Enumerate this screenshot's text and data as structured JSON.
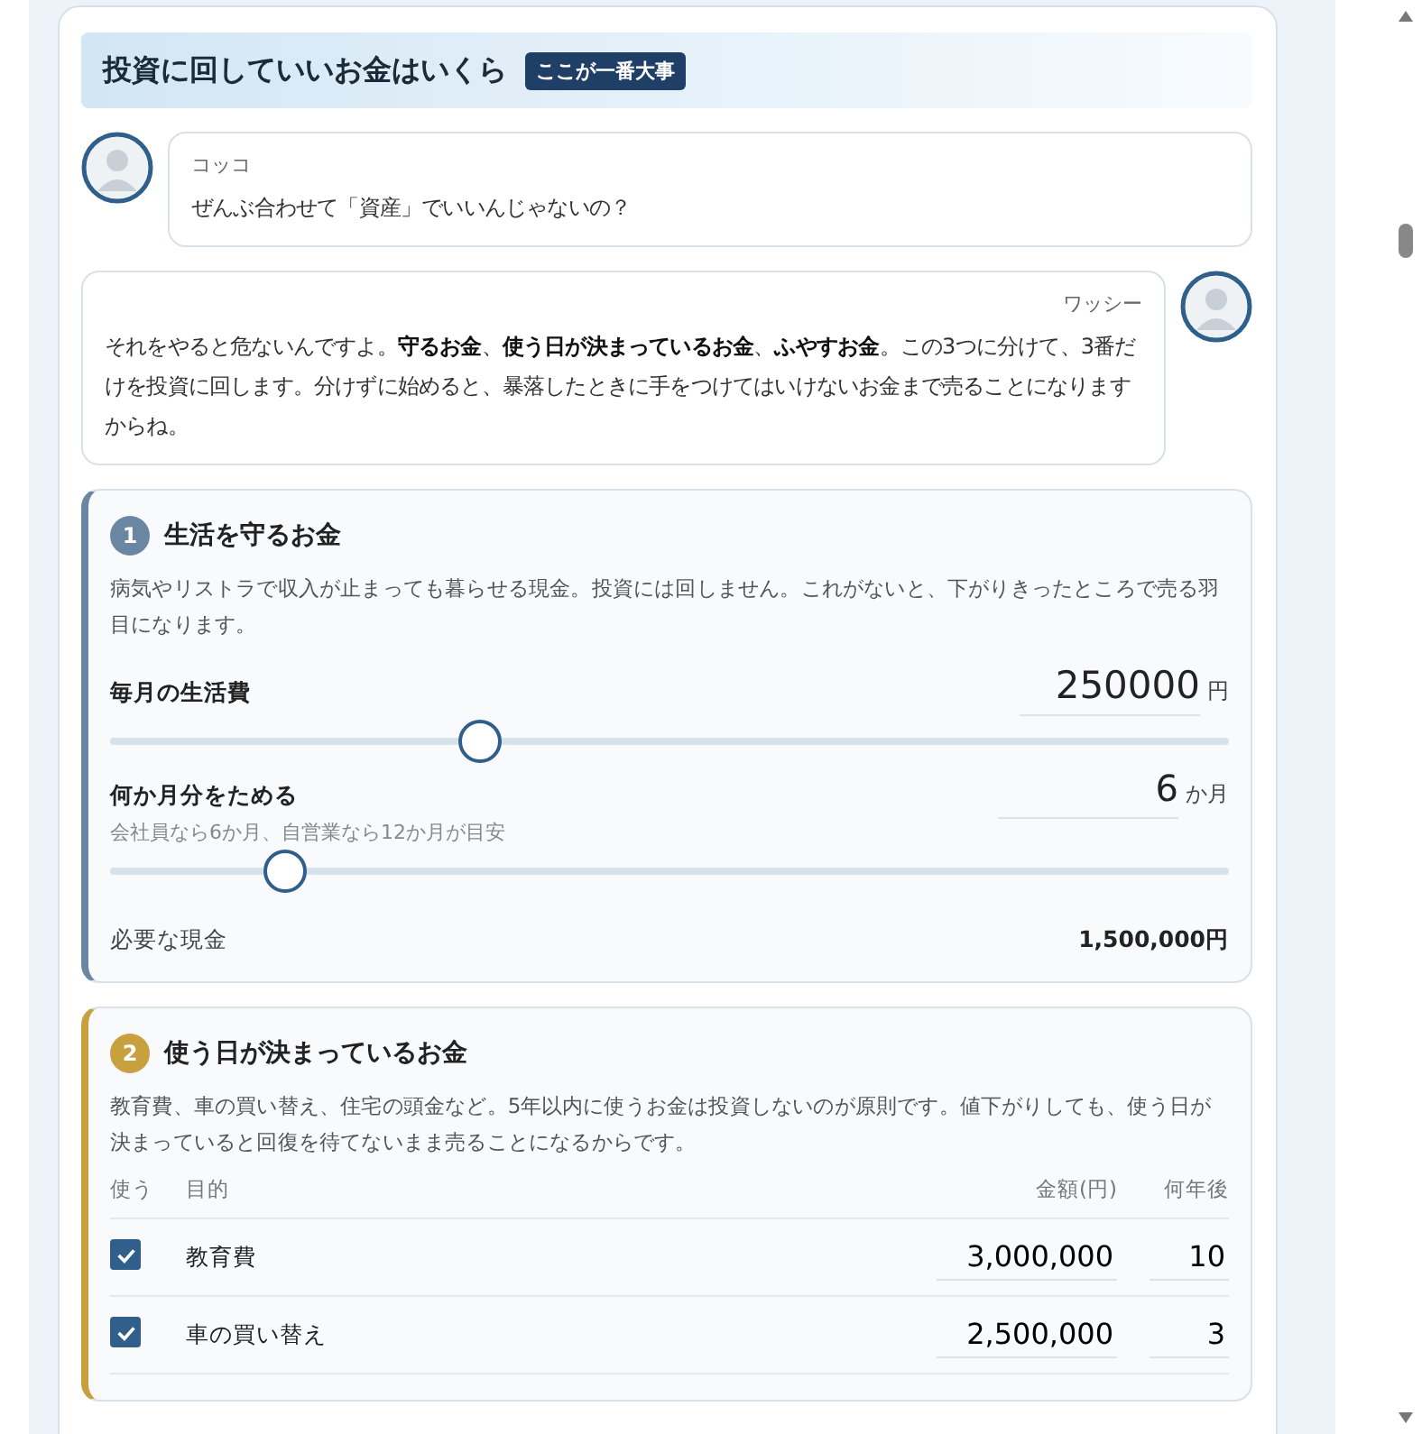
{
  "header": {
    "title": "投資に回していいお金はいくら",
    "badge": "ここが一番大事"
  },
  "chat": [
    {
      "kind": "left",
      "speaker": "コッコ",
      "text": "ぜんぶ合わせて「資産」でいいんじゃないの？"
    },
    {
      "kind": "right",
      "speaker": "ワッシー",
      "text": "それをやると危ないんですよ。**守るお金**、**使う日が決まっているお金**、**ふやすお金**。この3つに分けて、3番だけを投資に回します。分けずに始めると、暴落したときに手をつけてはいけないお金まで売ることになりますからね。"
    }
  ],
  "sections": [
    {
      "kind": "sliders",
      "number": "1",
      "color": "#6b86a3",
      "title": "生活を守るお金",
      "description": "病気やリストラで収入が止まっても暮らせる現金。投資には回しません。これがないと、下がりきったところで売る羽目になります。",
      "sliders": [
        {
          "label": "毎月の生活費",
          "value": "250000",
          "unit": "円",
          "level": 0.33
        },
        {
          "label": "何か月分をためる",
          "hint": "会社員なら6か月、自営業なら12か月が目安",
          "value": "6",
          "unit": "か月",
          "level": 0.157
        }
      ],
      "result": {
        "label": "必要な現金",
        "value": "1,500,000円"
      }
    },
    {
      "kind": "table",
      "number": "2",
      "color": "#c9a040",
      "title": "使う日が決まっているお金",
      "description": "教育費、車の買い替え、住宅の頭金など。5年以内に使うお金は投資しないのが原則です。値下がりしても、使う日が決まっていると回復を待てないまま売ることになるからです。",
      "columns": [
        "使う",
        "目的",
        "金額(円)",
        "何年後"
      ],
      "rows": [
        {
          "checked": true,
          "purpose": "教育費",
          "amount": "3,000,000",
          "years": "10"
        },
        {
          "checked": true,
          "purpose": "車の買い替え",
          "amount": "2,500,000",
          "years": "3"
        }
      ]
    }
  ]
}
